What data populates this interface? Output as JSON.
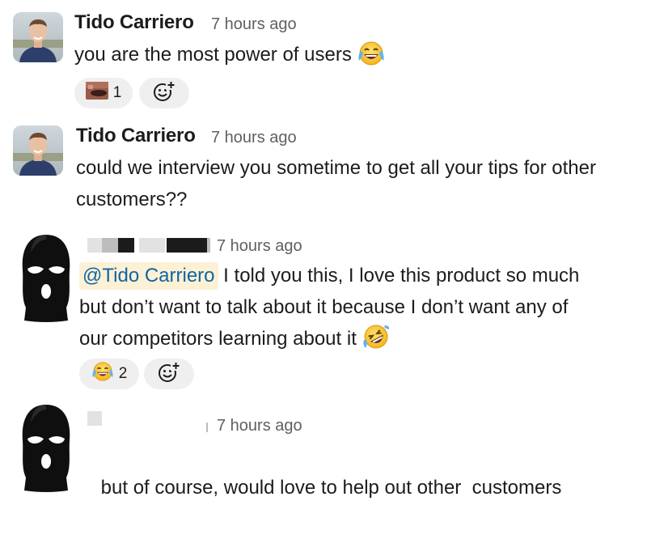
{
  "colors": {
    "text": "#1d1c1d",
    "timestamp": "#616061",
    "mention_text": "#1264a3",
    "mention_bg": "#fcf1d5",
    "reaction_bg": "#efefef"
  },
  "messages": [
    {
      "sender": "Tido Carriero",
      "timestamp": "7 hours ago",
      "text": "you are the most power of users",
      "trailing_emoji": "joy-emoji",
      "reactions": [
        {
          "emoji": "custom-face-emoji",
          "count": "1"
        }
      ]
    },
    {
      "sender": "Tido Carriero",
      "timestamp": "7 hours ago",
      "text_lines": [
        "could we interview you sometime to get all your tips for other",
        "customers??"
      ]
    },
    {
      "sender": "",
      "timestamp": "7 hours ago",
      "mention": "@Tido Carriero",
      "text_lines": [
        " I told you this, I love this product so much",
        "but don’t want to talk about it because I don’t want any of",
        "our competitors learning about it"
      ],
      "trailing_emoji": "rofl-emoji",
      "reactions": [
        {
          "emoji": "joy-emoji",
          "count": "2"
        }
      ]
    },
    {
      "sender": "",
      "timestamp": "7 hours ago",
      "text": "but of course, would love to help out other  customers"
    }
  ]
}
